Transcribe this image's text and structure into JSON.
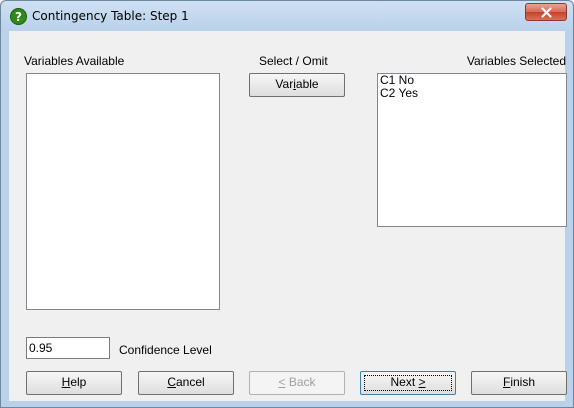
{
  "window": {
    "title": "Contingency Table: Step 1"
  },
  "labels": {
    "variables_available": "Variables Available",
    "select_omit": "Select / Omit",
    "variables_selected": "Variables Selected",
    "confidence_level": "Confidence Level"
  },
  "select_button": {
    "label_pre": "Var",
    "label_u": "i",
    "label_post": "able"
  },
  "variables_available": [],
  "variables_selected": [
    "C1 No",
    "C2 Yes"
  ],
  "confidence_input": {
    "value": "0.95"
  },
  "buttons": {
    "help": {
      "u": "H",
      "rest": "elp"
    },
    "cancel": {
      "u": "C",
      "rest": "ancel"
    },
    "back": {
      "u": "<",
      "rest": " Back"
    },
    "next": {
      "pre": "Next ",
      "u": ">"
    },
    "finish": {
      "u": "F",
      "rest": "inish"
    }
  },
  "colors": {
    "title_bar": "#b9d1ea",
    "client": "#f0f0f0",
    "close": "#c2432a"
  }
}
